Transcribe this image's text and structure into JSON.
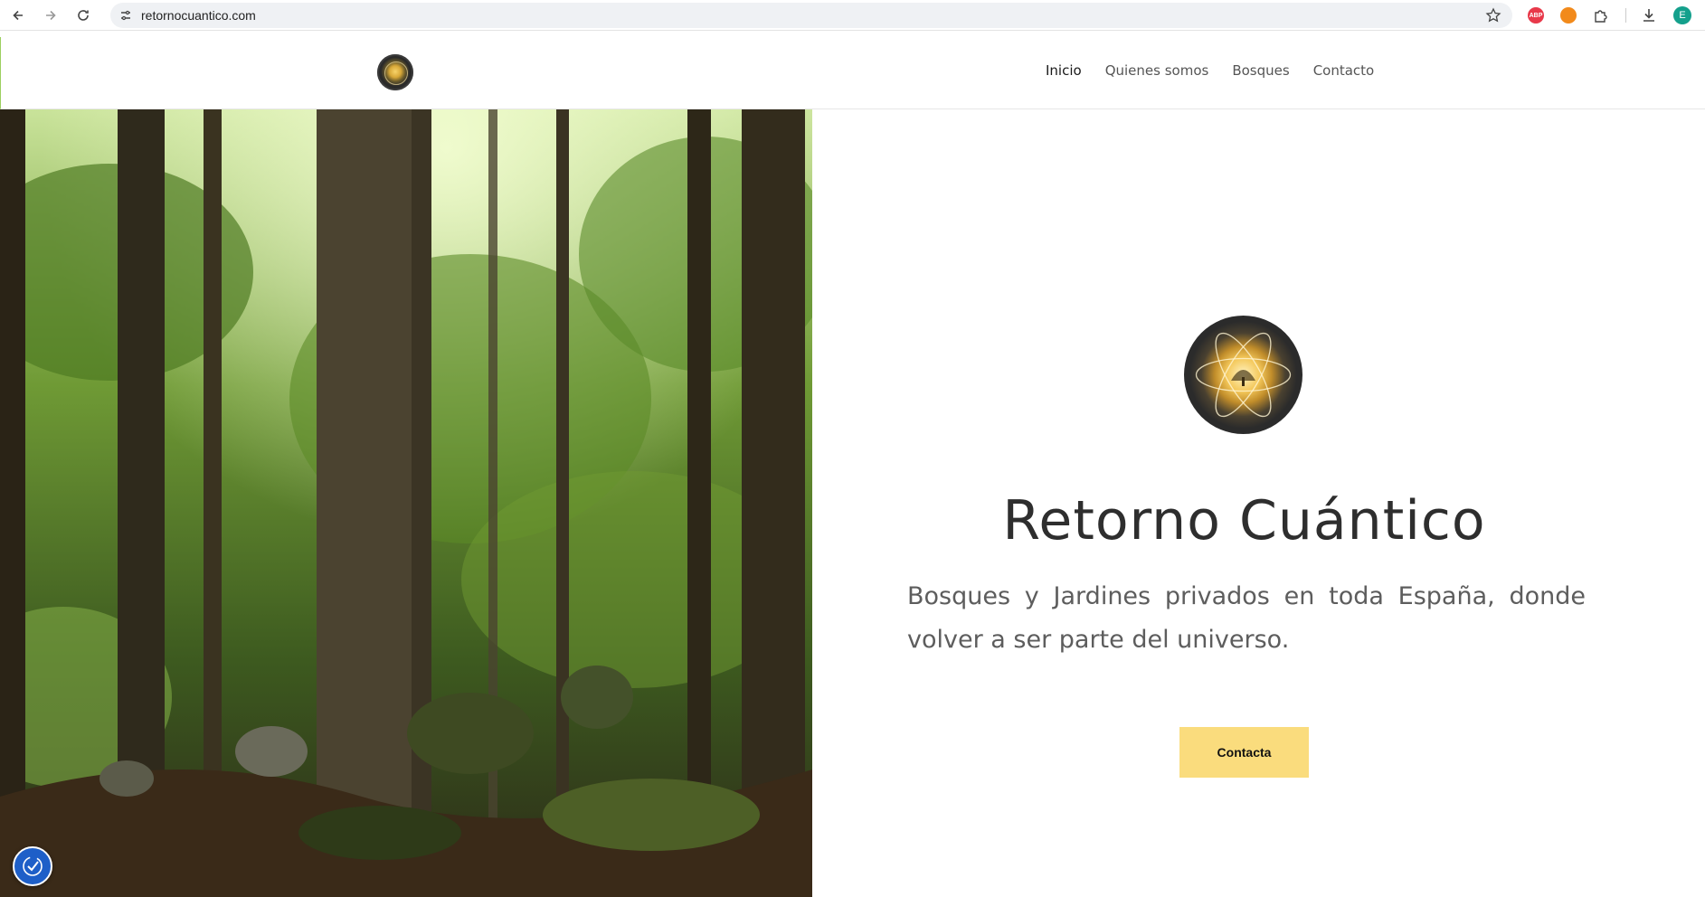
{
  "browser": {
    "url": "retornocuantico.com",
    "avatar_letter": "E",
    "ext_abp": "ABP"
  },
  "header": {
    "menu": [
      {
        "label": "Inicio",
        "active": true
      },
      {
        "label": "Quienes somos",
        "active": false
      },
      {
        "label": "Bosques",
        "active": false
      },
      {
        "label": "Contacto",
        "active": false
      }
    ]
  },
  "hero": {
    "title": "Retorno Cuántico",
    "subtitle": "Bosques y Jardines privados en toda España, donde volver a ser parte del universo.",
    "cta_label": "Contacta"
  },
  "colors": {
    "cta_bg": "#fadc7d",
    "a11y_bg": "#1e5fc8",
    "title": "#2e2e2e"
  },
  "icons": {
    "back": "arrow-left-icon",
    "forward": "arrow-right-icon",
    "reload": "reload-icon",
    "site_settings": "tune-icon",
    "bookmark": "star-icon",
    "extensions": "puzzle-icon",
    "downloads": "download-icon",
    "accessibility": "accessibility-icon"
  }
}
